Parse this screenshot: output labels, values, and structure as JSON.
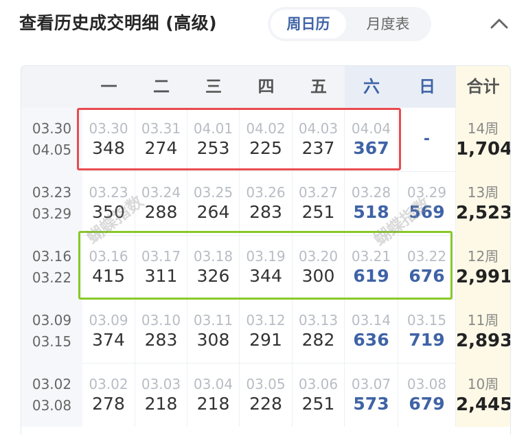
{
  "header": {
    "title": "查看历史成交明细 (高级)",
    "tabs": [
      {
        "label": "周日历",
        "active": true
      },
      {
        "label": "月度表",
        "active": false
      }
    ],
    "collapse_icon": "chevron-up-icon"
  },
  "grid": {
    "headers": [
      "一",
      "二",
      "三",
      "四",
      "五",
      "六",
      "日",
      "合计"
    ],
    "rows": [
      {
        "range_start": "03.30",
        "range_end": "04.05",
        "days": [
          {
            "date": "03.30",
            "value": "348"
          },
          {
            "date": "03.31",
            "value": "274"
          },
          {
            "date": "04.01",
            "value": "253"
          },
          {
            "date": "04.02",
            "value": "225"
          },
          {
            "date": "04.03",
            "value": "237"
          },
          {
            "date": "04.04",
            "value": "367"
          },
          {
            "date": "",
            "value": "-"
          }
        ],
        "week": "14周",
        "total": "1,704"
      },
      {
        "range_start": "03.23",
        "range_end": "03.29",
        "days": [
          {
            "date": "03.23",
            "value": "350"
          },
          {
            "date": "03.24",
            "value": "288"
          },
          {
            "date": "03.25",
            "value": "264"
          },
          {
            "date": "03.26",
            "value": "283"
          },
          {
            "date": "03.27",
            "value": "251"
          },
          {
            "date": "03.28",
            "value": "518"
          },
          {
            "date": "03.29",
            "value": "569"
          }
        ],
        "week": "13周",
        "total": "2,523"
      },
      {
        "range_start": "03.16",
        "range_end": "03.22",
        "days": [
          {
            "date": "03.16",
            "value": "415"
          },
          {
            "date": "03.17",
            "value": "311"
          },
          {
            "date": "03.18",
            "value": "326"
          },
          {
            "date": "03.19",
            "value": "344"
          },
          {
            "date": "03.20",
            "value": "300"
          },
          {
            "date": "03.21",
            "value": "619"
          },
          {
            "date": "03.22",
            "value": "676"
          }
        ],
        "week": "12周",
        "total": "2,991"
      },
      {
        "range_start": "03.09",
        "range_end": "03.15",
        "days": [
          {
            "date": "03.09",
            "value": "374"
          },
          {
            "date": "03.10",
            "value": "283"
          },
          {
            "date": "03.11",
            "value": "308"
          },
          {
            "date": "03.12",
            "value": "291"
          },
          {
            "date": "03.13",
            "value": "282"
          },
          {
            "date": "03.14",
            "value": "636"
          },
          {
            "date": "03.15",
            "value": "719"
          }
        ],
        "week": "11周",
        "total": "2,893"
      },
      {
        "range_start": "03.02",
        "range_end": "03.08",
        "days": [
          {
            "date": "03.02",
            "value": "278"
          },
          {
            "date": "03.03",
            "value": "218"
          },
          {
            "date": "03.04",
            "value": "218"
          },
          {
            "date": "03.05",
            "value": "228"
          },
          {
            "date": "03.06",
            "value": "251"
          },
          {
            "date": "03.07",
            "value": "573"
          },
          {
            "date": "03.08",
            "value": "679"
          }
        ],
        "week": "10周",
        "total": "2,445"
      }
    ]
  },
  "watermark": "蝴蝶指数",
  "colors": {
    "accent": "#3f63a6",
    "highlight_red": "#e94a4f",
    "highlight_green": "#88c827",
    "total_column_bg": "#fdf9e6"
  }
}
